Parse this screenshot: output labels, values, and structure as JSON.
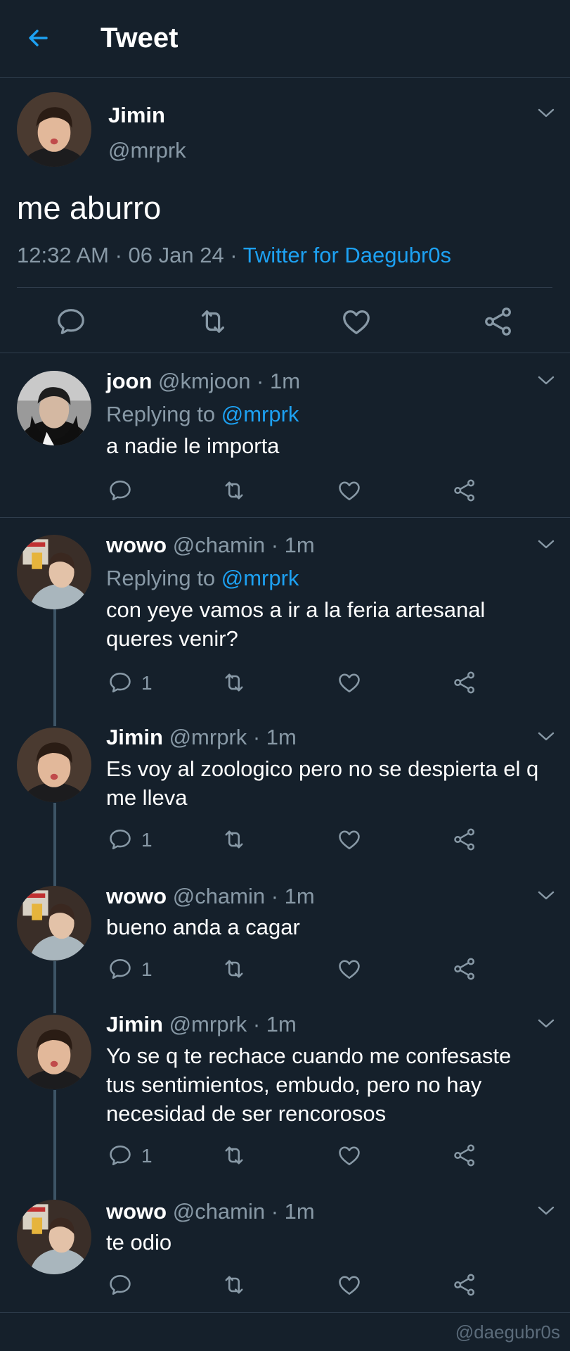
{
  "header": {
    "title": "Tweet"
  },
  "main_tweet": {
    "name": "Jimin",
    "handle": "@mrprk",
    "text": "me aburro",
    "time": "12:32 AM · 06 Jan 24 · ",
    "app": "Twitter for Daegubr0s"
  },
  "replies": [
    {
      "name": "joon",
      "handle": " @kmjoon · 1m",
      "replying_prefix": "Replying to ",
      "replying_to": "@mrprk",
      "lines": [
        "a nadie le importa"
      ],
      "reply_count": ""
    },
    {
      "name": "wowo",
      "handle": " @chamin · 1m",
      "replying_prefix": "Replying to ",
      "replying_to": "@mrprk",
      "lines": [
        "con yeye vamos a ir a la feria artesanal",
        "queres venir?"
      ],
      "reply_count": "1"
    },
    {
      "name": "Jimin",
      "handle": " @mrprk · 1m",
      "lines": [
        "Es voy al zoologico pero no se despierta el q",
        "me lleva"
      ],
      "reply_count": "1"
    },
    {
      "name": "wowo",
      "handle": " @chamin · 1m",
      "lines": [
        "bueno anda a cagar"
      ],
      "reply_count": "1"
    },
    {
      "name": "Jimin",
      "handle": " @mrprk · 1m",
      "lines": [
        "Yo se q te rechace cuando me confesaste",
        "tus sentimientos, embudo, pero no hay",
        "necesidad de ser rencorosos"
      ],
      "reply_count": "1"
    },
    {
      "name": "wowo",
      "handle": " @chamin · 1m",
      "lines": [
        "te odio"
      ],
      "reply_count": ""
    }
  ],
  "watermark": "@daegubr0s",
  "colors": {
    "background": "#15202b",
    "accent": "#1da1f2",
    "muted": "#8899a6",
    "divider": "#2f3d4c"
  }
}
